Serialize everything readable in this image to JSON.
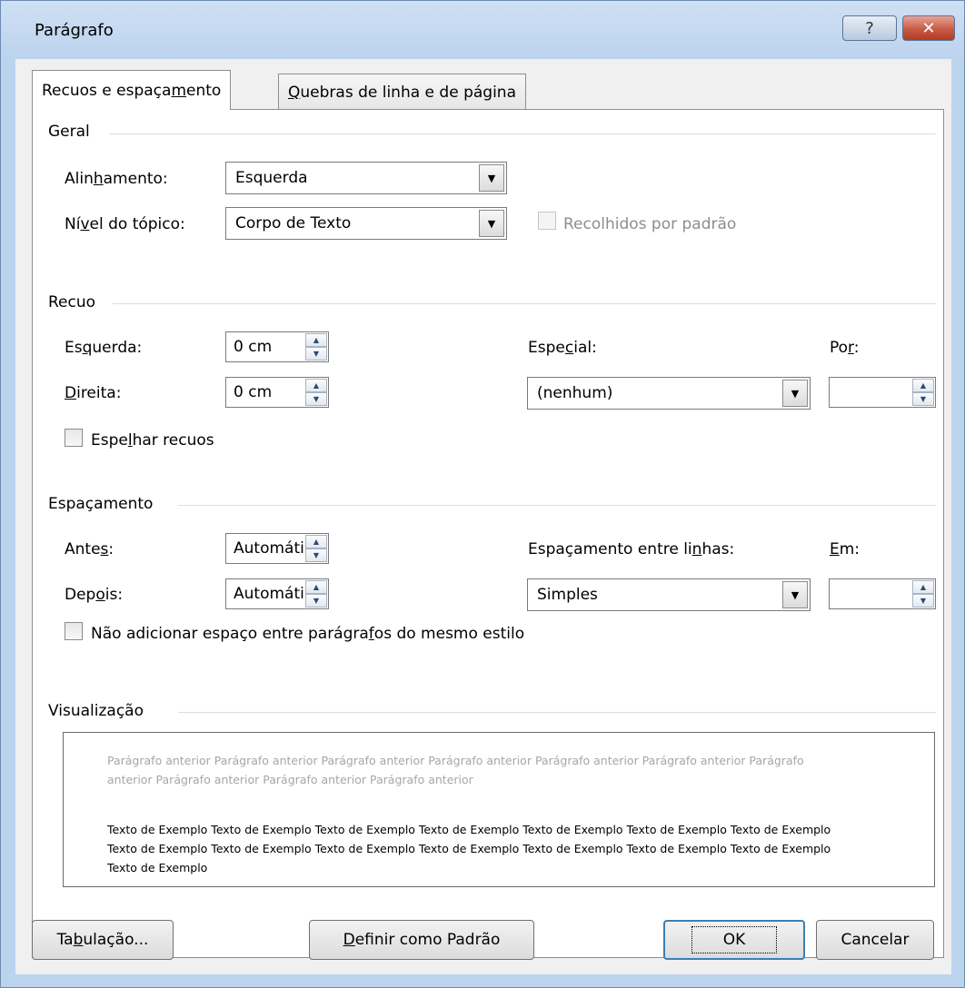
{
  "window": {
    "title": "Parágrafo",
    "help_label": "?",
    "close_label": "✕"
  },
  "tabs": [
    {
      "label_pre": "Recuos e espaça",
      "label_u": "m",
      "label_post": "ento",
      "active": true
    },
    {
      "label_pre": "",
      "label_u": "Q",
      "label_post": "uebras de linha e de página",
      "active": false
    }
  ],
  "geral": {
    "title": "Geral",
    "alinhamento": {
      "label_pre": "Alin",
      "label_u": "h",
      "label_post": "amento:",
      "value": "Esquerda"
    },
    "nivel": {
      "label_pre": "Ní",
      "label_u": "v",
      "label_post": "el do tópico:",
      "value": "Corpo de Texto"
    },
    "recolhidos": {
      "label": "Recolhidos por padrão",
      "checked": false,
      "enabled": false
    }
  },
  "recuo": {
    "title": "Recuo",
    "esquerda": {
      "label_pre": "Es",
      "label_u": "q",
      "label_post": "uerda:",
      "value": "0 cm"
    },
    "direita": {
      "label_pre": "",
      "label_u": "D",
      "label_post": "ireita:",
      "value": "0 cm"
    },
    "especial": {
      "label_pre": "Espe",
      "label_u": "c",
      "label_post": "ial:",
      "value": "(nenhum)"
    },
    "por": {
      "label_pre": "Po",
      "label_u": "r",
      "label_post": ":",
      "value": ""
    },
    "espelhar": {
      "label_pre": "Espe",
      "label_u": "l",
      "label_post": "har recuos",
      "checked": false
    }
  },
  "espacamento": {
    "title": "Espaçamento",
    "antes": {
      "label_pre": "Ante",
      "label_u": "s",
      "label_post": ":",
      "value": "Automático"
    },
    "depois": {
      "label_pre": "Dep",
      "label_u": "o",
      "label_post": "is:",
      "value": "Automático"
    },
    "entre_linhas": {
      "label_pre": "Espaçamento entre li",
      "label_u": "n",
      "label_post": "has:",
      "value": "Simples"
    },
    "em": {
      "label_pre": "",
      "label_u": "E",
      "label_post": "m:",
      "value": ""
    },
    "nao_adicionar": {
      "label_pre": "Não adicionar espaço entre parágra",
      "label_u": "f",
      "label_post": "os do mesmo estilo",
      "checked": false
    }
  },
  "visualizacao": {
    "title": "Visualização",
    "previous_paragraph": "Parágrafo anterior Parágrafo anterior Parágrafo anterior Parágrafo anterior Parágrafo anterior Parágrafo anterior Parágrafo anterior Parágrafo anterior Parágrafo anterior Parágrafo anterior",
    "sample_text": "Texto de Exemplo Texto de Exemplo Texto de Exemplo Texto de Exemplo Texto de Exemplo Texto de Exemplo Texto de Exemplo Texto de Exemplo Texto de Exemplo Texto de Exemplo Texto de Exemplo Texto de Exemplo Texto de Exemplo Texto de Exemplo Texto de Exemplo"
  },
  "buttons": {
    "tabulacao": {
      "label_pre": "Ta",
      "label_u": "b",
      "label_post": "ulação..."
    },
    "definir": {
      "label_pre": "",
      "label_u": "D",
      "label_post": "efinir como Padrão"
    },
    "ok": {
      "label": "OK"
    },
    "cancelar": {
      "label": "Cancelar"
    }
  }
}
